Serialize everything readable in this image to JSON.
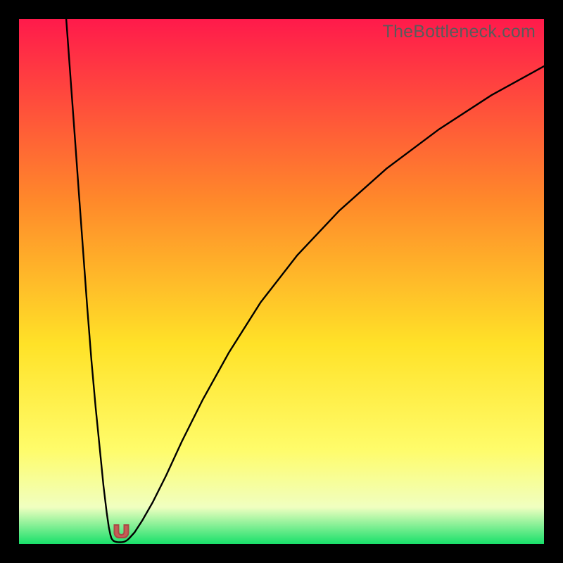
{
  "watermark": "TheBottleneck.com",
  "colors": {
    "frame": "#000000",
    "curve": "#000000",
    "marker_fill": "#c65b55",
    "marker_stroke": "#a84a45",
    "gradient_top": "#ff1a4b",
    "gradient_mid_upper": "#ff8a2a",
    "gradient_mid": "#ffe228",
    "gradient_mid_lower": "#fffc6a",
    "gradient_near_bottom": "#f0ffc0",
    "gradient_bottom": "#18e06a"
  },
  "chart_data": {
    "type": "line",
    "title": "",
    "xlabel": "",
    "ylabel": "",
    "xlim": [
      0,
      100
    ],
    "ylim": [
      0,
      100
    ],
    "series": [
      {
        "name": "left-branch",
        "x": [
          9.0,
          9.8,
          10.6,
          11.4,
          12.2,
          13.0,
          13.8,
          14.6,
          15.4,
          16.1,
          16.7,
          17.1,
          17.4,
          17.6,
          17.8,
          18.0
        ],
        "y": [
          100.0,
          89.0,
          78.0,
          67.0,
          56.0,
          45.0,
          35.0,
          26.0,
          18.0,
          11.0,
          6.0,
          3.2,
          1.8,
          1.1,
          0.8,
          0.6
        ]
      },
      {
        "name": "optimum-cup",
        "x": [
          18.0,
          18.3,
          18.6,
          18.9,
          19.2,
          19.5,
          19.8,
          20.1,
          20.4,
          20.7,
          21.0
        ],
        "y": [
          0.6,
          0.45,
          0.38,
          0.35,
          0.34,
          0.35,
          0.38,
          0.45,
          0.6,
          0.8,
          1.1
        ]
      },
      {
        "name": "right-branch",
        "x": [
          21.0,
          22.0,
          23.5,
          25.5,
          28.0,
          31.0,
          35.0,
          40.0,
          46.0,
          53.0,
          61.0,
          70.0,
          80.0,
          90.0,
          100.0
        ],
        "y": [
          1.1,
          2.2,
          4.5,
          8.0,
          13.0,
          19.5,
          27.5,
          36.5,
          46.0,
          55.0,
          63.5,
          71.5,
          79.0,
          85.5,
          91.0
        ]
      }
    ],
    "marker": {
      "x": 19.5,
      "y": 1.2,
      "shape": "cup"
    }
  }
}
